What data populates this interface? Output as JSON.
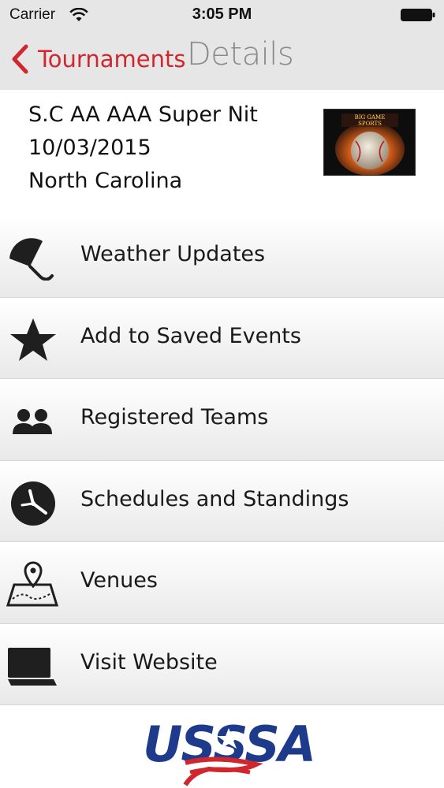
{
  "status_bar": {
    "carrier": "Carrier",
    "time": "3:05 PM"
  },
  "nav": {
    "back_label": "Tournaments",
    "title": "Details"
  },
  "tournament": {
    "name": "S.C AA AAA Super Nit",
    "date": "10/03/2015",
    "location": "North Carolina"
  },
  "menu": [
    {
      "label": "Weather Updates",
      "icon": "umbrella-icon"
    },
    {
      "label": "Add to Saved Events",
      "icon": "star-icon"
    },
    {
      "label": "Registered Teams",
      "icon": "users-icon"
    },
    {
      "label": "Schedules and Standings",
      "icon": "clock-icon"
    },
    {
      "label": "Venues",
      "icon": "map-pin-icon"
    },
    {
      "label": "Visit Website",
      "icon": "laptop-icon"
    }
  ],
  "colors": {
    "accent": "#d0272e",
    "bar_background": "#e6e6e6",
    "logo_blue": "#1e3a8a",
    "logo_red": "#d0272e"
  }
}
